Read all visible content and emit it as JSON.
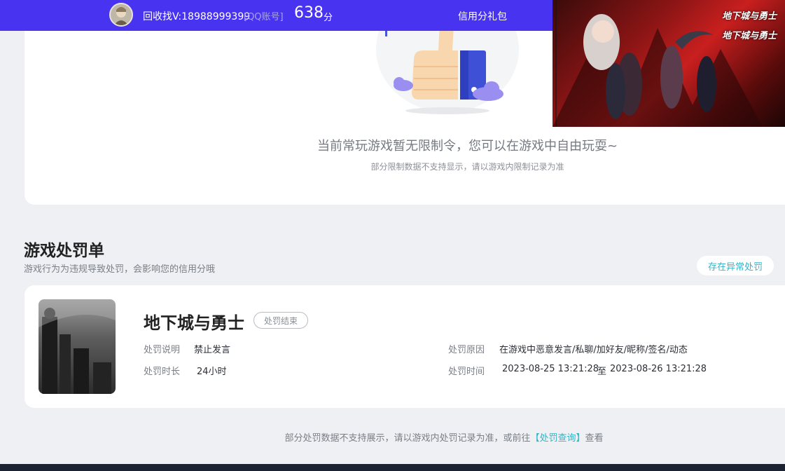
{
  "topbar": {
    "user_label": "回收找V:18988999399",
    "account_tag": "[QQ账号]",
    "score": "638",
    "score_unit": "分",
    "gift_link": "信用分礼包"
  },
  "banner": {
    "logo_text": "地下城与勇士"
  },
  "restriction": {
    "message": "当前常玩游戏暂无限制令，您可以在游戏中自由玩耍~",
    "note": "部分限制数据不支持显示，请以游戏内限制记录为准"
  },
  "penalty_section": {
    "title": "游戏处罚单",
    "subtitle": "游戏行为为违规导致处罚，会影响您的信用分哦",
    "appeal_button": "存在异常处罚"
  },
  "penalty": {
    "game_name": "地下城与勇士",
    "status": "处罚结束",
    "desc_label": "处罚说明",
    "desc_value": "禁止发言",
    "duration_label": "处罚时长",
    "duration_value": "24小时",
    "reason_label": "处罚原因",
    "reason_value": "在游戏中恶意发言/私聊/加好友/昵称/签名/动态",
    "time_label": "处罚时间",
    "time_start": "2023-08-25 13:21:28",
    "time_sep": "至",
    "time_end": "2023-08-26 13:21:28"
  },
  "footer": {
    "text_before": "部分处罚数据不支持展示，请以游戏内处罚记录为准，或前往",
    "link_text": "【处罚查询】",
    "text_after": "查看"
  },
  "colors": {
    "topbar": "#4833f0",
    "accent": "#34b4c6",
    "background": "#eef0f3"
  }
}
